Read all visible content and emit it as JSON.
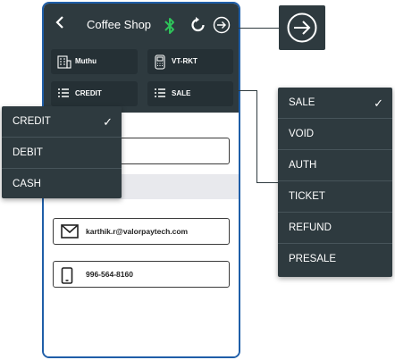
{
  "header": {
    "title": "Coffee Shop",
    "back_icon": "chevron-left-icon",
    "icons": [
      "bluetooth-icon",
      "refresh-icon",
      "logout-icon"
    ],
    "colors": {
      "bar": "#2e3a3f",
      "bluetooth": "#2ec45a",
      "frame": "#1f5ea8"
    }
  },
  "chips": {
    "store": {
      "label": "Muthu",
      "icon": "store-icon"
    },
    "device": {
      "label": "VT-RKT",
      "icon": "terminal-icon"
    },
    "payment": {
      "label": "CREDIT",
      "icon": "list-icon"
    },
    "transaction": {
      "label": "SALE",
      "icon": "list-icon"
    }
  },
  "contact": {
    "email": "karthik.r@valorpaytech.com",
    "phone": "996-564-8160"
  },
  "payment_menu": {
    "items": [
      {
        "label": "CREDIT",
        "selected": true
      },
      {
        "label": "DEBIT",
        "selected": false
      },
      {
        "label": "CASH",
        "selected": false
      }
    ],
    "check": "✓"
  },
  "transaction_menu": {
    "items": [
      {
        "label": "SALE",
        "selected": true
      },
      {
        "label": "VOID",
        "selected": false
      },
      {
        "label": "AUTH",
        "selected": false
      },
      {
        "label": "TICKET",
        "selected": false
      },
      {
        "label": "REFUND",
        "selected": false
      },
      {
        "label": "PRESALE",
        "selected": false
      }
    ],
    "check": "✓"
  }
}
